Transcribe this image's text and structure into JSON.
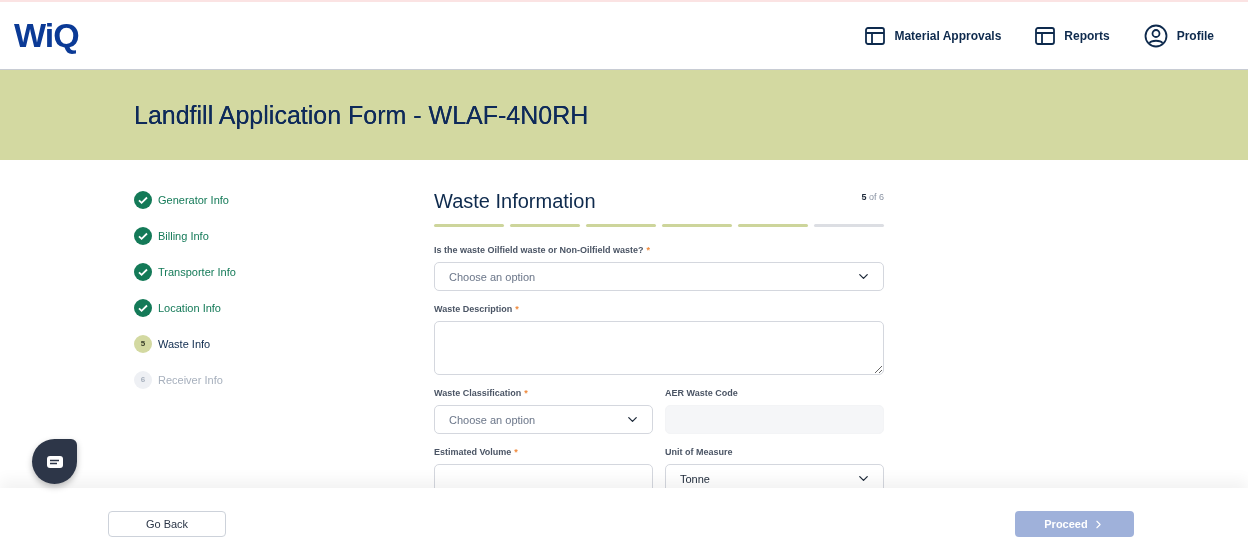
{
  "header": {
    "logo": "WiQ",
    "nav": [
      {
        "label": "Material Approvals",
        "kind": "layout"
      },
      {
        "label": "Reports",
        "kind": "layout"
      },
      {
        "label": "Profile",
        "kind": "user"
      }
    ]
  },
  "banner": {
    "title": "Landfill Application Form - WLAF-4N0RH"
  },
  "steps": [
    {
      "label": "Generator Info",
      "completed": true,
      "selected": false
    },
    {
      "label": "Billing Info",
      "completed": true,
      "selected": false
    },
    {
      "label": "Transporter Info",
      "completed": true,
      "selected": false
    },
    {
      "label": "Location Info",
      "completed": true,
      "selected": false
    },
    {
      "number": "5",
      "label": "Waste Info",
      "completed": false,
      "selected": true
    },
    {
      "number": "6",
      "label": "Receiver Info",
      "completed": false,
      "selected": false
    }
  ],
  "form": {
    "title": "Waste Information",
    "step_current": "5",
    "step_total": "of 6",
    "required_mark": "*",
    "progress": [
      {
        "complete": true
      },
      {
        "complete": true
      },
      {
        "complete": true
      },
      {
        "complete": true
      },
      {
        "complete": true
      },
      {
        "complete": false
      }
    ],
    "rows": [
      [
        {
          "kind": "select",
          "label": "Is the waste Oilfield waste or Non-Oilfield waste?",
          "required": true,
          "placeholder": "Choose an option"
        }
      ],
      [
        {
          "kind": "textarea",
          "label": "Waste Description",
          "required": true
        }
      ],
      [
        {
          "kind": "select",
          "label": "Waste Classification",
          "required": true,
          "placeholder": "Choose an option"
        },
        {
          "kind": "text",
          "label": "AER Waste Code",
          "required": false,
          "disabled": true
        }
      ],
      [
        {
          "kind": "text",
          "label": "Estimated Volume",
          "required": true,
          "disabled": false
        },
        {
          "kind": "select",
          "label": "Unit of Measure",
          "required": false,
          "value": "Tonne"
        }
      ]
    ]
  },
  "footer": {
    "back": "Go Back",
    "proceed": {
      "label": "Proceed",
      "disabled": true
    }
  }
}
